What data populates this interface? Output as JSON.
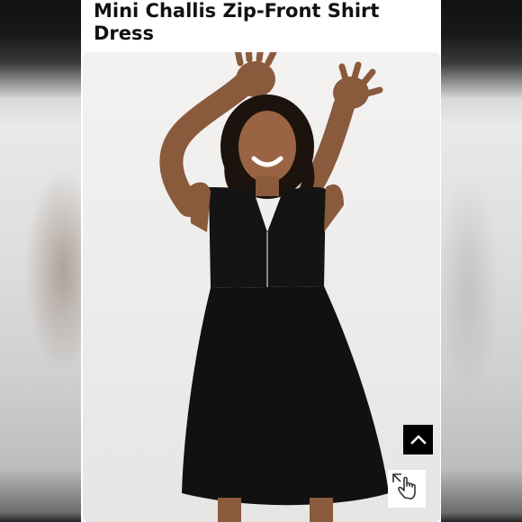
{
  "product": {
    "title": "Mini Challis Zip-Front Shirt Dress",
    "image_subject": "woman-in-black-sleeveless-dress"
  },
  "controls": {
    "scroll_top_icon": "chevron-up-icon",
    "zoom_icon": "hand-pointer-expand-icon"
  },
  "colors": {
    "card": "#ffffff",
    "title": "#111111",
    "dress": "#111111",
    "button": "#000000"
  }
}
